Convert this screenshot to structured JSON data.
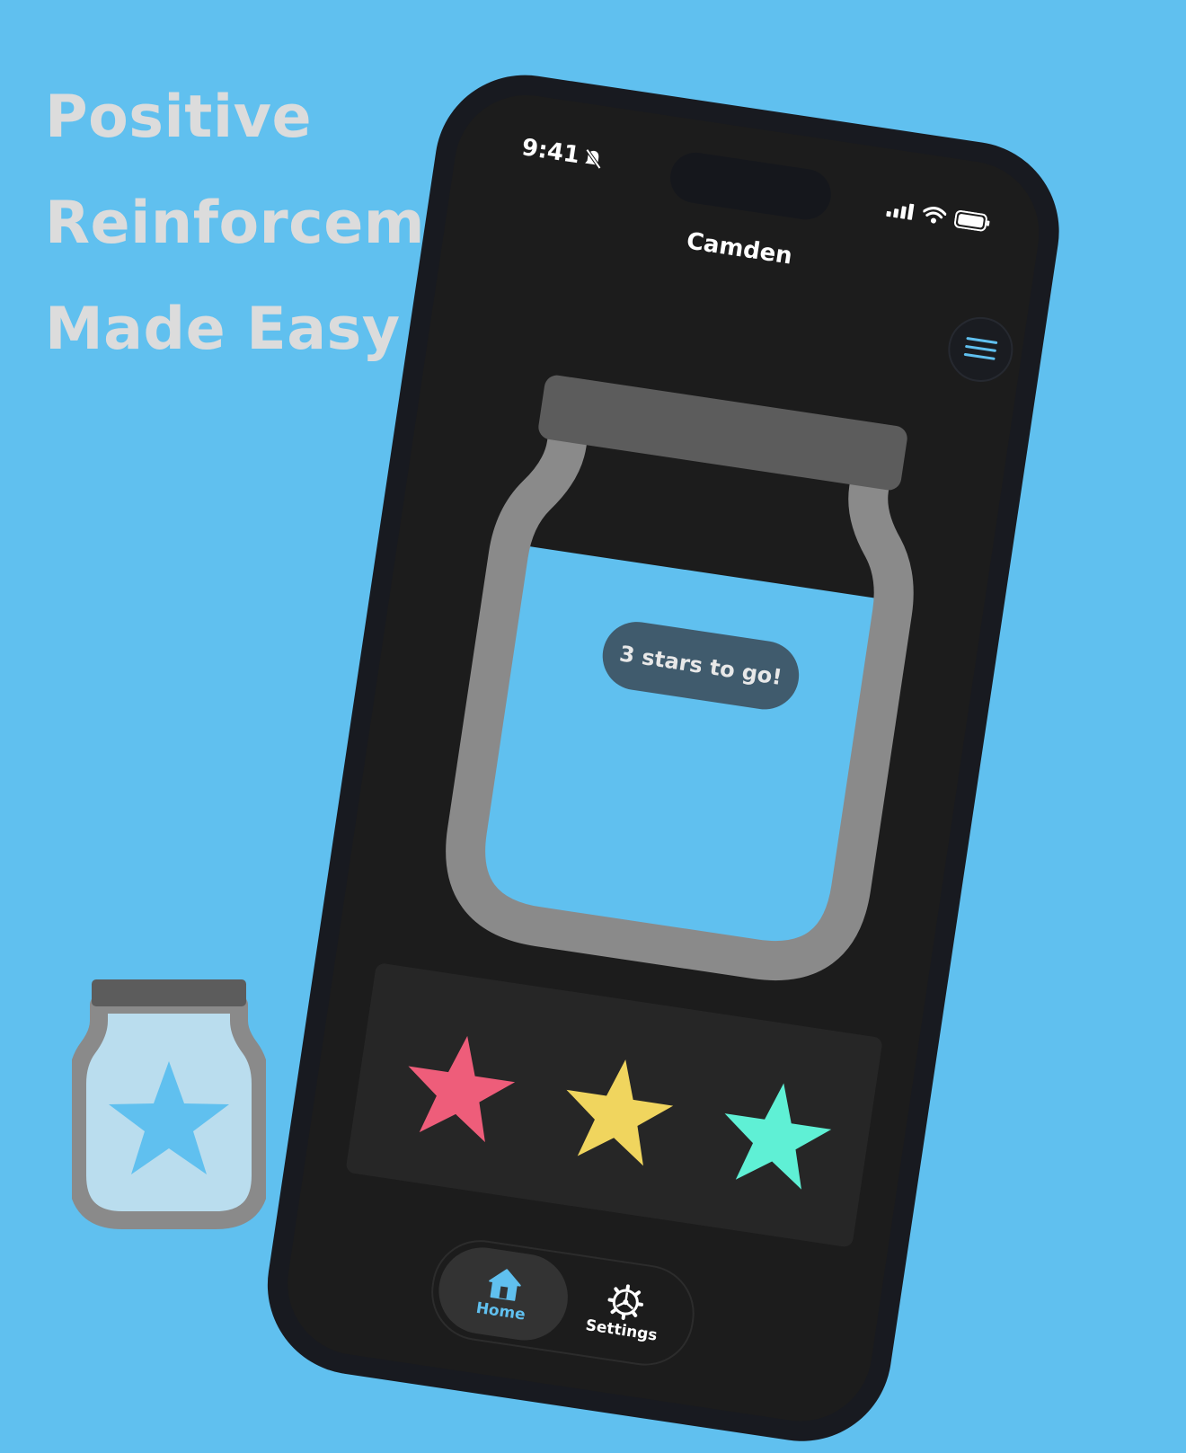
{
  "marketing": {
    "lines": [
      "Positive",
      "Reinforcement",
      "Made Easy"
    ]
  },
  "status_bar": {
    "time": "9:41"
  },
  "header": {
    "title": "Camden",
    "menu_icon": "hamburger-menu-icon"
  },
  "jar": {
    "progress_message": "3 stars to go!",
    "fill_fraction": 0.75
  },
  "stars": [
    {
      "color": "#EE5D7A"
    },
    {
      "color": "#F0D55E"
    },
    {
      "color": "#5FF0D5"
    }
  ],
  "tabs": [
    {
      "label": "Home",
      "icon": "house-icon",
      "active": true
    },
    {
      "label": "Settings",
      "icon": "gear-icon",
      "active": false
    }
  ],
  "colors": {
    "background": "#60C0EF",
    "jar_outline": "#8A8A8A",
    "jar_lid": "#5C5C5C",
    "jar_fill": "#60C0EF"
  }
}
